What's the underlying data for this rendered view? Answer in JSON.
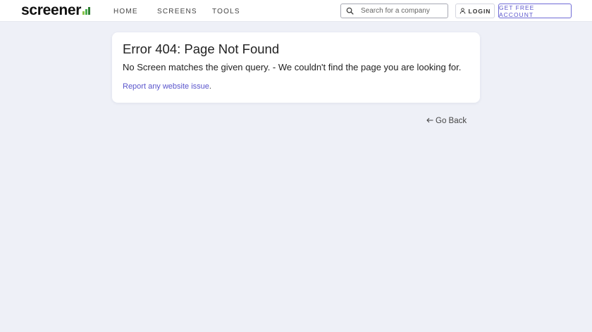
{
  "header": {
    "logo_text": "screener",
    "nav": [
      {
        "label": "HOME"
      },
      {
        "label": "SCREENS"
      },
      {
        "label": "TOOLS"
      }
    ],
    "search": {
      "placeholder": "Search for a company"
    },
    "login_label": "LOGIN",
    "signup_label": "GET FREE ACCOUNT"
  },
  "error": {
    "title": "Error 404: Page Not Found",
    "message": "No Screen matches the given query. - We couldn't find the page you are looking for.",
    "report_link": "Report any website issue",
    "report_suffix": "."
  },
  "go_back_label": "Go Back",
  "colors": {
    "accent": "#5a55cc",
    "background": "#eef0f7"
  }
}
